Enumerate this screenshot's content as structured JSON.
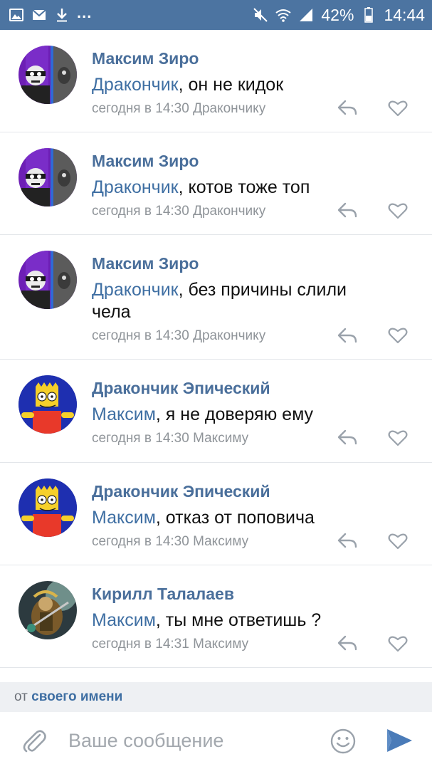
{
  "status_bar": {
    "left_icons": [
      "image-icon",
      "mail-icon",
      "download-icon"
    ],
    "more": "...",
    "battery": "42%",
    "time": "14:44"
  },
  "comments": [
    {
      "author": "Максим Зиро",
      "mention": "Дракончик",
      "text": ", он не кидок",
      "meta": "сегодня в 14:30 Дракончику",
      "avatar": "avatar-maxim"
    },
    {
      "author": "Максим Зиро",
      "mention": "Дракончик",
      "text": ", котов тоже топ",
      "meta": "сегодня в 14:30 Дракончику",
      "avatar": "avatar-maxim"
    },
    {
      "author": "Максим Зиро",
      "mention": "Дракончик",
      "text": ", без причины слили чела",
      "meta": "сегодня в 14:30 Дракончику",
      "avatar": "avatar-maxim"
    },
    {
      "author": "Дракончик Эпический",
      "mention": "Максим",
      "text": ", я не доверяю ему",
      "meta": "сегодня в 14:30 Максиму",
      "avatar": "avatar-bart"
    },
    {
      "author": "Дракончик Эпический",
      "mention": "Максим",
      "text": ", отказ от поповича",
      "meta": "сегодня в 14:30 Максиму",
      "avatar": "avatar-bart"
    },
    {
      "author": "Кирилл Талалаев",
      "mention": "Максим",
      "text": ", ты мне ответишь ?",
      "meta": "сегодня в 14:31 Максиму",
      "avatar": "avatar-kirill"
    }
  ],
  "from_name": {
    "prefix": "от",
    "link": "своего имени"
  },
  "composer": {
    "placeholder": "Ваше сообщение",
    "value": ""
  },
  "colors": {
    "status_bar": "#4c74a1",
    "author": "#4a6f9b",
    "mention": "#3f6fa3",
    "meta": "#8f9499",
    "send": "#4a7bb8"
  }
}
